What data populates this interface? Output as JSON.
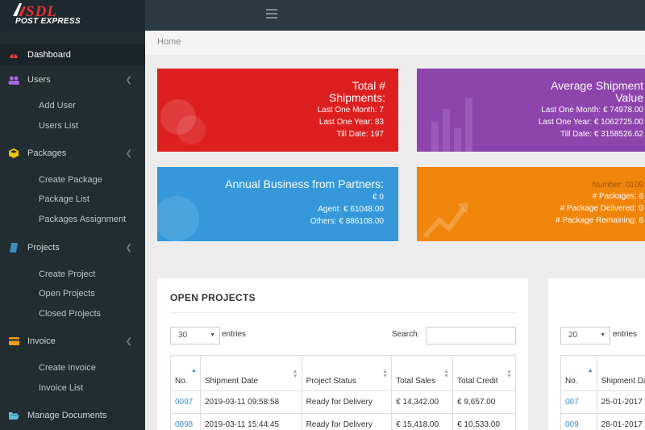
{
  "brand": {
    "name": "SDL",
    "tagline": "POST EXPRESS"
  },
  "breadcrumb": "Home",
  "sidebar": {
    "dashboard": "Dashboard",
    "users": "Users",
    "users_items": [
      "Add User",
      "Users List"
    ],
    "packages": "Packages",
    "packages_items": [
      "Create Package",
      "Package List",
      "Packages Assignment"
    ],
    "projects": "Projects",
    "projects_items": [
      "Create Project",
      "Open Projects",
      "Closed Projects"
    ],
    "invoice": "Invoice",
    "invoice_items": [
      "Create Invoice",
      "Invoice List"
    ],
    "documents": "Manage Documents"
  },
  "cards": {
    "shipments": {
      "title1": "Total #",
      "title2": "Shipments:",
      "l1": "Last One Month: 7",
      "l2": "Last One Year: 83",
      "l3": "Till Date: 197",
      "color": "#dd1f1f"
    },
    "avg": {
      "title1": "Average Shipment",
      "title2": "Value",
      "l1": "Last One Month: € 74978.00",
      "l2": "Last One Year: € 1062725.00",
      "l3": "Till Date: € 3158526.62",
      "color": "#8e44ad"
    },
    "annual": {
      "title": "Annual Business from Partners:",
      "l1": "€ 0",
      "l2": "Agent: € 61048.00",
      "l3": "Others: € 886108.00",
      "color": "#3498db"
    },
    "packages": {
      "l0": "Number: 0109",
      "l1": "# Packages: 6",
      "l2": "# Package Delivered: 0",
      "l3": "# Package Remaining: 6",
      "color": "#f0850b"
    }
  },
  "open_projects": {
    "title": "OPEN PROJECTS",
    "entries_value": "30",
    "entries_label": "entries",
    "search_label": "Search:",
    "columns": [
      "No.",
      "Shipment Date",
      "Project Status",
      "Total Sales",
      "Total Credit"
    ],
    "rows": [
      [
        "0097",
        "2019-03-11 09:58:58",
        "Ready for Delivery",
        "€ 14,342.00",
        "€ 9,657.00"
      ],
      [
        "0098",
        "2019-03-11 15:44:45",
        "Ready for Delivery",
        "€ 15,418.00",
        "€ 10,533.00"
      ]
    ]
  },
  "second_table": {
    "entries_value": "20",
    "entries_label": "entries",
    "columns": [
      "No.",
      "Shipment Date"
    ],
    "rows": [
      [
        "007",
        "25-01-2017"
      ],
      [
        "009",
        "28-01-2017"
      ]
    ]
  }
}
